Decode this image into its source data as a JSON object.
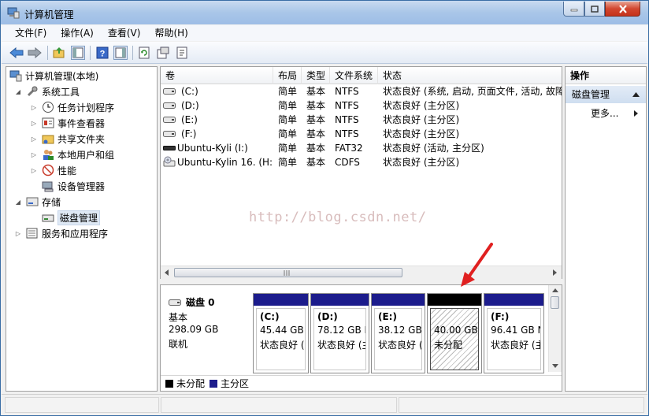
{
  "window": {
    "title": "计算机管理"
  },
  "menu": [
    "文件(F)",
    "操作(A)",
    "查看(V)",
    "帮助(H)"
  ],
  "toolbar": [
    "back-icon",
    "forward-icon",
    "up-folder-icon",
    "show-hide-tree-icon",
    "help-icon",
    "show-hide-action-icon",
    "refresh-icon",
    "properties-icon",
    "export-icon"
  ],
  "tree": {
    "root": "计算机管理(本地)",
    "system_tools": "系统工具",
    "task_scheduler": "任务计划程序",
    "event_viewer": "事件查看器",
    "shared_folders": "共享文件夹",
    "local_users": "本地用户和组",
    "performance": "性能",
    "device_manager": "设备管理器",
    "storage": "存储",
    "disk_management": "磁盘管理",
    "services": "服务和应用程序"
  },
  "list": {
    "headers": [
      "卷",
      "布局",
      "类型",
      "文件系统",
      "状态"
    ],
    "rows": [
      [
        "(C:)",
        "简单",
        "基本",
        "NTFS",
        "状态良好 (系统, 启动, 页面文件, 活动, 故障"
      ],
      [
        "(D:)",
        "简单",
        "基本",
        "NTFS",
        "状态良好 (主分区)"
      ],
      [
        "(E:)",
        "简单",
        "基本",
        "NTFS",
        "状态良好 (主分区)"
      ],
      [
        "(F:)",
        "简单",
        "基本",
        "NTFS",
        "状态良好 (主分区)"
      ],
      [
        "Ubuntu-Kyli (I:)",
        "简单",
        "基本",
        "FAT32",
        "状态良好 (活动, 主分区)"
      ],
      [
        "Ubuntu-Kylin 16. (H:)",
        "简单",
        "基本",
        "CDFS",
        "状态良好 (主分区)"
      ]
    ],
    "watermark": "http://blog.csdn.net/"
  },
  "disk": {
    "name": "磁盘 0",
    "type": "基本",
    "size": "298.09 GB",
    "status": "联机",
    "partitions": [
      {
        "label": "(C:)",
        "size": "45.44 GB",
        "status": "状态良好 ("
      },
      {
        "label": "(D:)",
        "size": "78.12 GB I",
        "status": "状态良好 (主"
      },
      {
        "label": "(E:)",
        "size": "38.12 GB",
        "status": "状态良好 ("
      },
      {
        "label": "",
        "size": "40.00 GB",
        "status": "未分配"
      },
      {
        "label": "(F:)",
        "size": "96.41 GB N",
        "status": "状态良好 (主"
      }
    ]
  },
  "legend": {
    "unallocated": "未分配",
    "primary": "主分区"
  },
  "actions": {
    "header": "操作",
    "section": "磁盘管理",
    "more": "更多..."
  },
  "colors": {
    "primary_partition": "#1c1c8c",
    "unallocated": "#000000"
  }
}
